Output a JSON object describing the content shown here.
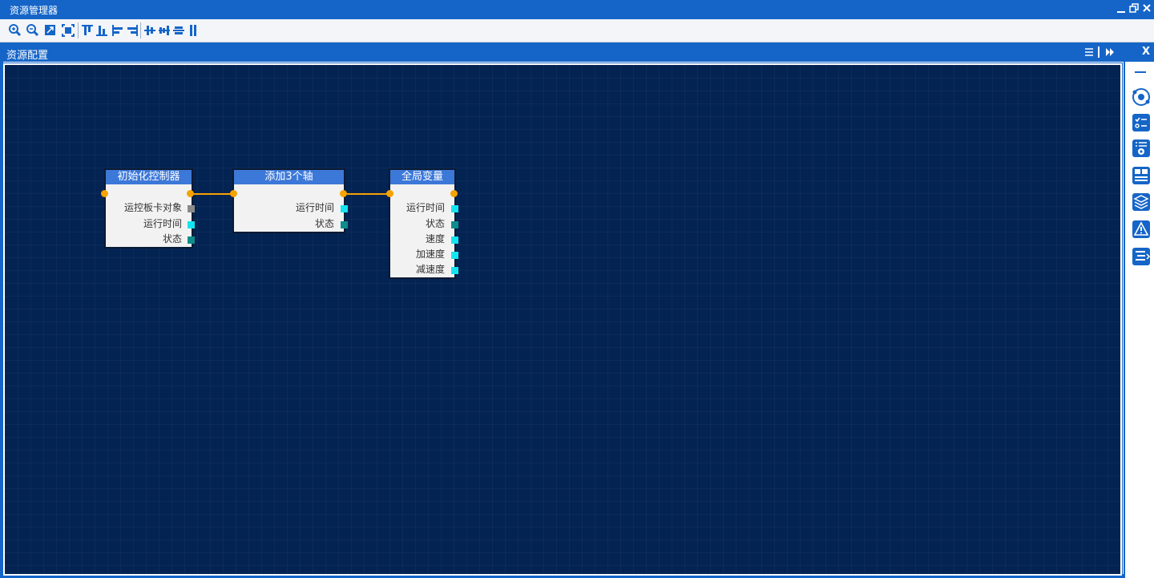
{
  "window": {
    "title": "资源管理器",
    "controls": [
      "minimize",
      "restore",
      "close"
    ]
  },
  "toolbar": {
    "buttons": [
      "zoom-in-icon",
      "zoom-out-icon",
      "fit-icon",
      "fit-all-icon",
      "align-top-icon",
      "align-bottom-icon",
      "align-left-icon",
      "align-right-icon",
      "align-center-horizontal-icon",
      "align-center-vertical-icon",
      "distribute-horizontal-icon",
      "distribute-vertical-icon"
    ]
  },
  "panel": {
    "title": "资源配置",
    "close_label": "X"
  },
  "nodes": [
    {
      "title": "初始化控制器",
      "rows": [
        {
          "label": "运控板卡对象",
          "port_color": "gray"
        },
        {
          "label": "运行时间",
          "port_color": "cyan"
        },
        {
          "label": "状态",
          "port_color": "teal"
        }
      ]
    },
    {
      "title": "添加3个轴",
      "rows": [
        {
          "label": "运行时间",
          "port_color": "cyan"
        },
        {
          "label": "状态",
          "port_color": "teal"
        }
      ]
    },
    {
      "title": "全局变量",
      "rows": [
        {
          "label": "运行时间",
          "port_color": "cyan"
        },
        {
          "label": "状态",
          "port_color": "teal"
        },
        {
          "label": "速度",
          "port_color": "cyan"
        },
        {
          "label": "加速度",
          "port_color": "cyan"
        },
        {
          "label": "减速度",
          "port_color": "cyan"
        }
      ]
    }
  ],
  "right_panel": {
    "buttons": [
      "orbit-icon",
      "checklist-icon",
      "settings-list-icon",
      "form-icon",
      "layers-icon",
      "warning-icon",
      "list-export-icon"
    ]
  },
  "colors": {
    "accent": "#1565c8",
    "canvas": "#032352",
    "node_header": "#3c78d8",
    "exec_port": "#f5a300",
    "data_port_cyan": "#14e4f0",
    "data_port_teal": "#0f8c8c"
  }
}
